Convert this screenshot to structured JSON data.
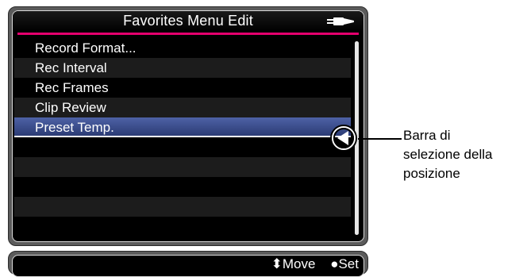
{
  "screen": {
    "title": "Favorites Menu Edit",
    "battery_icon": "battery-icon",
    "menu_items": [
      {
        "label": "Record Format..."
      },
      {
        "label": "Rec Interval"
      },
      {
        "label": "Rec Frames"
      },
      {
        "label": "Clip Review"
      },
      {
        "label": "Preset Temp.",
        "selected": true
      }
    ],
    "status_bar": {
      "move_label": "⬍Move",
      "set_label": "●Set"
    },
    "accent_color": "#e4006e",
    "selection_color": "#3b4d8f"
  },
  "callout": {
    "lines": [
      "Barra di",
      "selezione della",
      "posizione"
    ]
  }
}
